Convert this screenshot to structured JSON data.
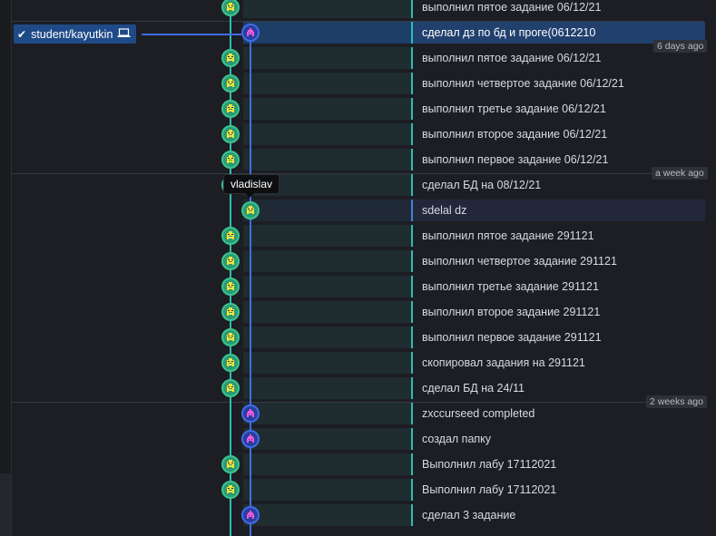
{
  "branch": {
    "name": "student/kayutkin"
  },
  "tooltip": {
    "author": "vladislav"
  },
  "time_labels": [
    "6 days ago",
    "a week ago",
    "2 weeks ago"
  ],
  "colors": {
    "lane_green": "#2dbdb4",
    "lane_blue": "#3f6de8",
    "selected_row": "#22406e",
    "branch_badge": "#1f4a88"
  },
  "commits": [
    {
      "message": "выполнил пятое задание 06/12/21",
      "author": "green"
    },
    {
      "message": "сделал дз по бд и проге(0612210",
      "author": "blue"
    },
    {
      "message": "выполнил пятое задание 06/12/21",
      "author": "green"
    },
    {
      "message": "выполнил четвертое задание 06/12/21",
      "author": "green"
    },
    {
      "message": "выполнил третье задание 06/12/21",
      "author": "green"
    },
    {
      "message": "выполнил второе задание 06/12/21",
      "author": "green"
    },
    {
      "message": "выполнил первое задание 06/12/21",
      "author": "green"
    },
    {
      "message": "сделал БД на 08/12/21",
      "author": "green"
    },
    {
      "message": "sdelal dz",
      "author": "green"
    },
    {
      "message": "выполнил пятое задание 291121",
      "author": "green"
    },
    {
      "message": "выполнил четвертое задание 291121",
      "author": "green"
    },
    {
      "message": "выполнил третье задание 291121",
      "author": "green"
    },
    {
      "message": "выполнил второе задание 291121",
      "author": "green"
    },
    {
      "message": "выполнил первое задание 291121",
      "author": "green"
    },
    {
      "message": "скопировал задания на 291121",
      "author": "green"
    },
    {
      "message": "сделал БД на 24/11",
      "author": "green"
    },
    {
      "message": "zxccurseed completed",
      "author": "blue"
    },
    {
      "message": "создал папку",
      "author": "blue"
    },
    {
      "message": "Выполнил лабу 17112021",
      "author": "green"
    },
    {
      "message": "Выполнил лабу 17112021",
      "author": "green"
    },
    {
      "message": "сделал 3 задание",
      "author": "blue"
    }
  ]
}
